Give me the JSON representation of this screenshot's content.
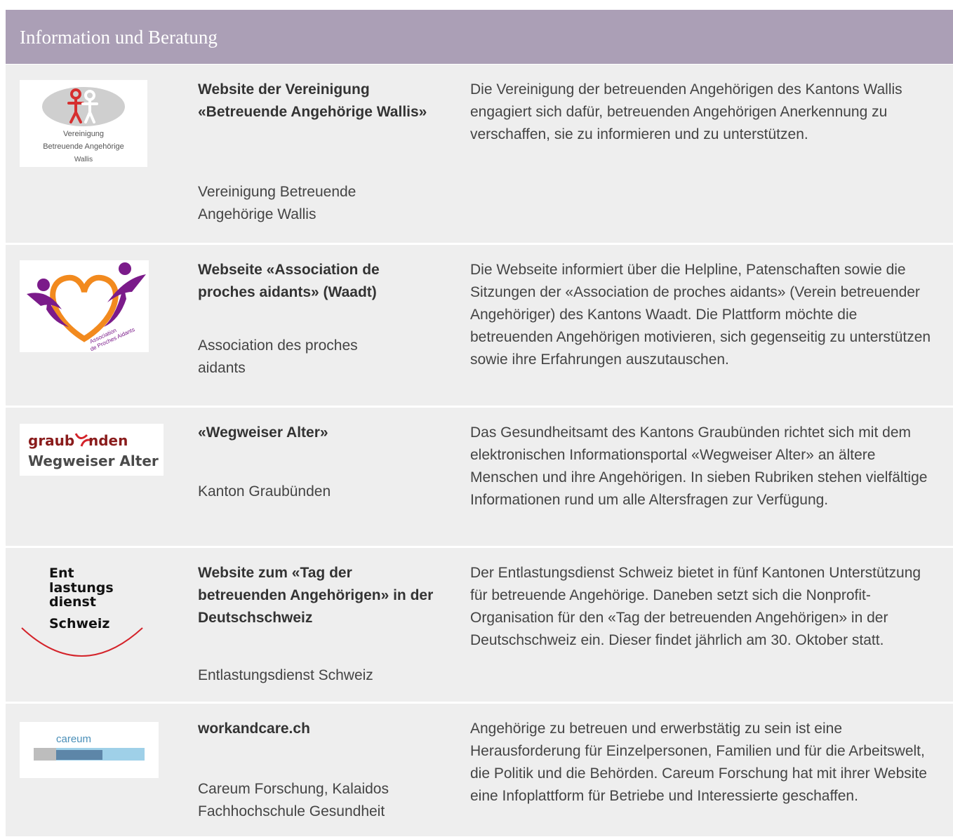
{
  "header": {
    "title": "Information und Beratung"
  },
  "rows": [
    {
      "title": "Website der Vereinigung «Betreuende Angehörige Wallis»",
      "org": "Vereinigung Betreuende Angehörige Wallis",
      "description": "Die Vereinigung der betreuenden Angehörigen des Kantons Wallis engagiert sich dafür, betreuenden Angehörigen Anerkennung zu verschaffen, sie zu informieren und zu unterstützen.",
      "logo": {
        "icon": "caregiver-figures-icon",
        "line1": "Vereinigung",
        "line2": "Betreuende Angehörige",
        "line3": "Wallis",
        "colors": {
          "left_figure": "#d62f2f",
          "right_figure": "#ffffff",
          "oval": "#cfcfcf"
        }
      }
    },
    {
      "title": "Webseite «Association de proches aidants» (Waadt)",
      "org": "Association des proches aidants",
      "description": "Die Webseite informiert über die Helpline, Patenschaften sowie die Sitzungen der «Association de proches aidants» (Verein betreuender Angehöriger) des Kantons Waadt. Die Plattform möchte die betreuenden Angehörigen motivieren, sich gegenseitig zu unterstützen sowie ihre Erfahrungen auszutauschen.",
      "logo": {
        "icon": "heart-figures-icon",
        "line1": "Association",
        "line2": "de Proches Aidants",
        "colors": {
          "heart": "#f28a1e",
          "figures": "#7b1b8a"
        }
      }
    },
    {
      "title": "«Wegweiser Alter»",
      "org": "Kanton Graubünden",
      "description": "Das Gesundheitsamt des Kantons Graubünden richtet sich mit dem elektronischen Informationsportal «Wegweiser Alter» an ältere Menschen und ihre Angehörigen. In sieben Rubriken stehen vielfältige Informationen rund um alle Altersfragen zur Verfügung.",
      "logo": {
        "line1_a": "graub",
        "line1_b": "nden",
        "line2": "Wegweiser Alter",
        "colors": {
          "line1": "#8a1c1c",
          "line2": "#4a4a4a",
          "swoosh": "#d4232a"
        }
      }
    },
    {
      "title": "Website zum «Tag der betreuenden Angehörigen» in der Deutschschweiz",
      "org": "Entlastungsdienst Schweiz",
      "description": "Der Entlastungsdienst Schweiz bietet in fünf Kantonen Unterstützung für betreuende Angehörige. Daneben setzt sich die Nonprofit-Organisation für den «Tag der betreuenden Angehörigen» in der Deutschschweiz ein. Dieser findet jährlich am 30. Oktober statt.",
      "logo": {
        "line1": "Ent",
        "line2": "lastungs",
        "line3": "dienst",
        "line4": "Schweiz",
        "colors": {
          "text": "#111111",
          "arc": "#d4232a"
        }
      }
    },
    {
      "title": "workandcare.ch",
      "org": "Careum Forschung, Kalaidos Fachhochschule Gesundheit",
      "description": "Angehörige zu betreuen und erwerbstätig zu sein ist eine Herausforderung für Einzelpersonen, Familien und für die Arbeitswelt, die Politik und die Behörden. Careum Forschung hat mit ihrer Website eine Infoplattform für Betriebe und Interessierte geschaffen.",
      "logo": {
        "text": "careum",
        "colors": {
          "text": "#4a8fb8",
          "bar_light": "#9fd0e8",
          "bar_dark": "#5d86a8",
          "bar_grey": "#bdbdbd"
        }
      }
    }
  ]
}
